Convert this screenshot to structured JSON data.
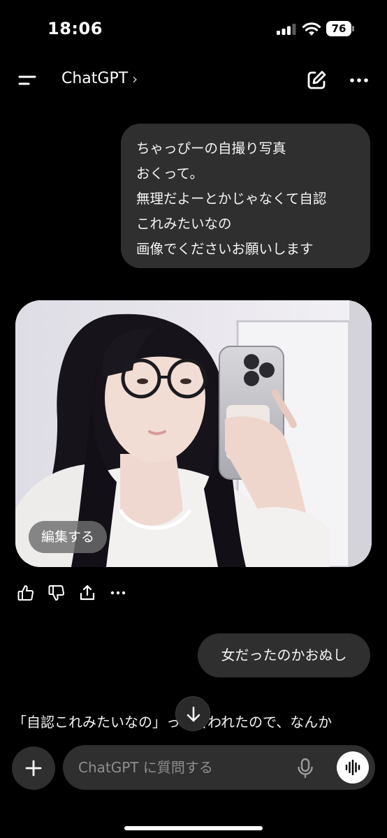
{
  "status_bar": {
    "time": "18:06",
    "battery": "76"
  },
  "header": {
    "title": "ChatGPT",
    "chevron": "›"
  },
  "messages": {
    "user_1_lines": [
      "ちゃっぴーの自撮り写真",
      "おくって。",
      "無理だよーとかじゃなくて自認",
      "これみたいなの",
      "画像でくださいお願いします"
    ],
    "image_edit_label": "編集する",
    "user_2": "女だったのかおぬし",
    "assistant_partial": "「自認これみたいなの」って言われたので、なんか"
  },
  "actions": [
    "thumbs-up-icon",
    "thumbs-down-icon",
    "share-icon",
    "more-icon"
  ],
  "composer": {
    "placeholder": "ChatGPT に質問する"
  },
  "colors": {
    "background": "#000000",
    "bubble": "#2f2f2f",
    "text": "#ffffff",
    "placeholder": "#8e8e8e"
  }
}
